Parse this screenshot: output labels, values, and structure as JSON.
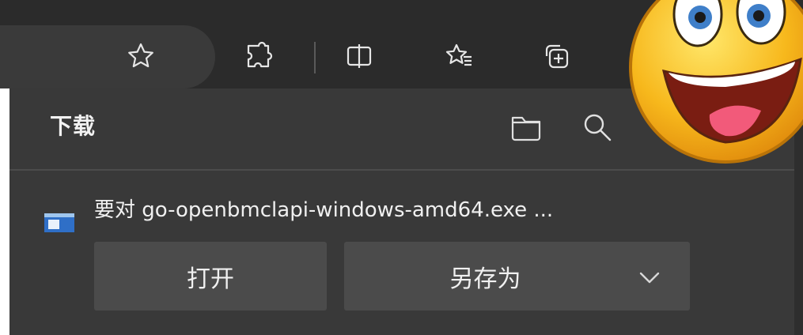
{
  "panel": {
    "title": "下载"
  },
  "download": {
    "filename": "要对 go-openbmclapi-windows-amd64.exe ...",
    "open_label": "打开",
    "save_as_label": "另存为"
  },
  "icons": {
    "toolbar": [
      "star-icon",
      "extensions-icon",
      "split-screen-icon",
      "favorites-icon",
      "collections-icon"
    ],
    "header": [
      "folder-icon",
      "search-icon"
    ],
    "file": "exe-file-icon",
    "dropdown": "chevron-down-icon"
  },
  "colors": {
    "toolbar_bg": "#2b2b2b",
    "panel_bg": "#393939",
    "button_bg": "#4b4b4b",
    "text": "#f0f0f0"
  }
}
